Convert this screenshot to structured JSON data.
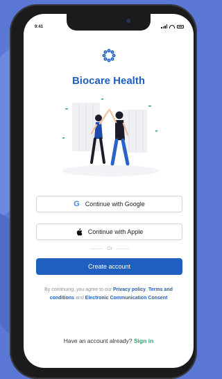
{
  "status_bar": {
    "time": "9:41"
  },
  "brand": {
    "name": "Biocare Health",
    "color": "#1f5fbf"
  },
  "auth": {
    "google_label": "Continue with Google",
    "apple_label": "Continue with Apple",
    "divider_text": "Or",
    "create_label": "Create account"
  },
  "legal": {
    "prefix": "By continuing, you agree to our",
    "privacy": "Privacy policy",
    "comma": ",",
    "terms": "Terms and conditions",
    "and": "and",
    "consent": "Electronic Communication Consent"
  },
  "footer": {
    "have_account": "Have an account already?",
    "signin_label": "Sign in"
  },
  "icons": {
    "logo": "biocare-logo-icon",
    "google": "google-icon",
    "apple": "apple-icon"
  },
  "colors": {
    "primary": "#1f5fbf",
    "accent_green": "#2aa36f"
  }
}
